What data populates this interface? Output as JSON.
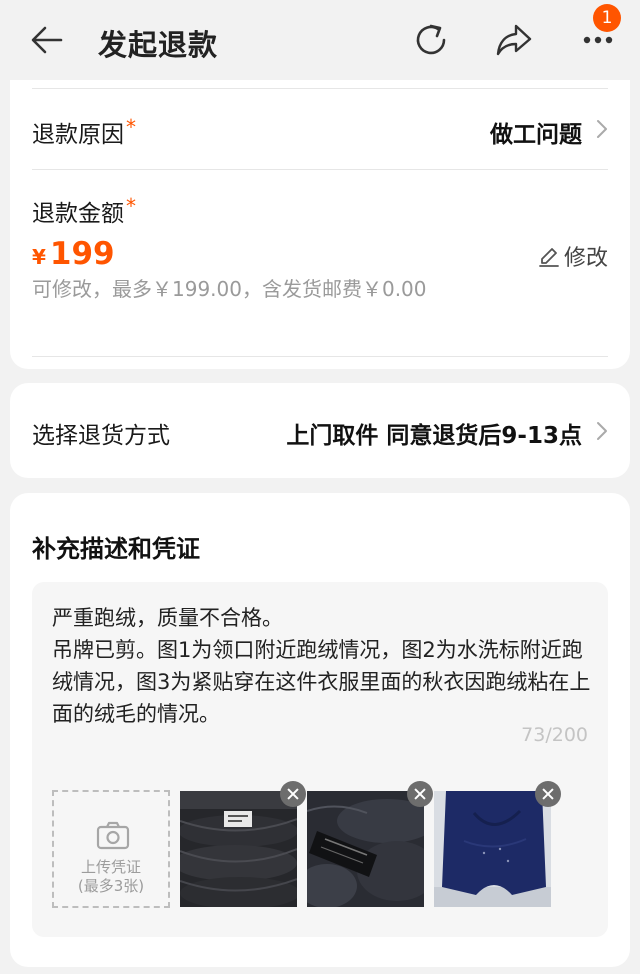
{
  "header": {
    "title": "发起退款",
    "badge_count": "1",
    "icons": [
      "back-arrow-icon",
      "refresh-icon",
      "share-icon",
      "more-icon"
    ]
  },
  "refund": {
    "reason_label": "退款原因",
    "reason_value": "做工问题",
    "amount_label": "退款金额",
    "required_mark": "*",
    "currency": "¥",
    "amount": "199",
    "edit_label": "修改",
    "hint_text": "可修改，最多￥199.00，含发货邮费￥0.00"
  },
  "return_method": {
    "label": "选择退货方式",
    "value": "上门取件 同意退货后9-13点"
  },
  "evidence": {
    "title": "补充描述和凭证",
    "description": "严重跑绒，质量不合格。\n吊牌已剪。图1为领口附近跑绒情况，图2为水洗标附近跑绒情况，图3为紧贴穿在这件衣服里面的秋衣因跑绒粘在上面的绒毛的情况。",
    "counter": "73/200",
    "upload_label": "上传凭证",
    "upload_limit": "(最多3张)",
    "photos": [
      "photo-1",
      "photo-2",
      "photo-3"
    ]
  },
  "colors": {
    "accent": "#ff5500",
    "background": "#f2f2f2",
    "card": "#ffffff"
  }
}
